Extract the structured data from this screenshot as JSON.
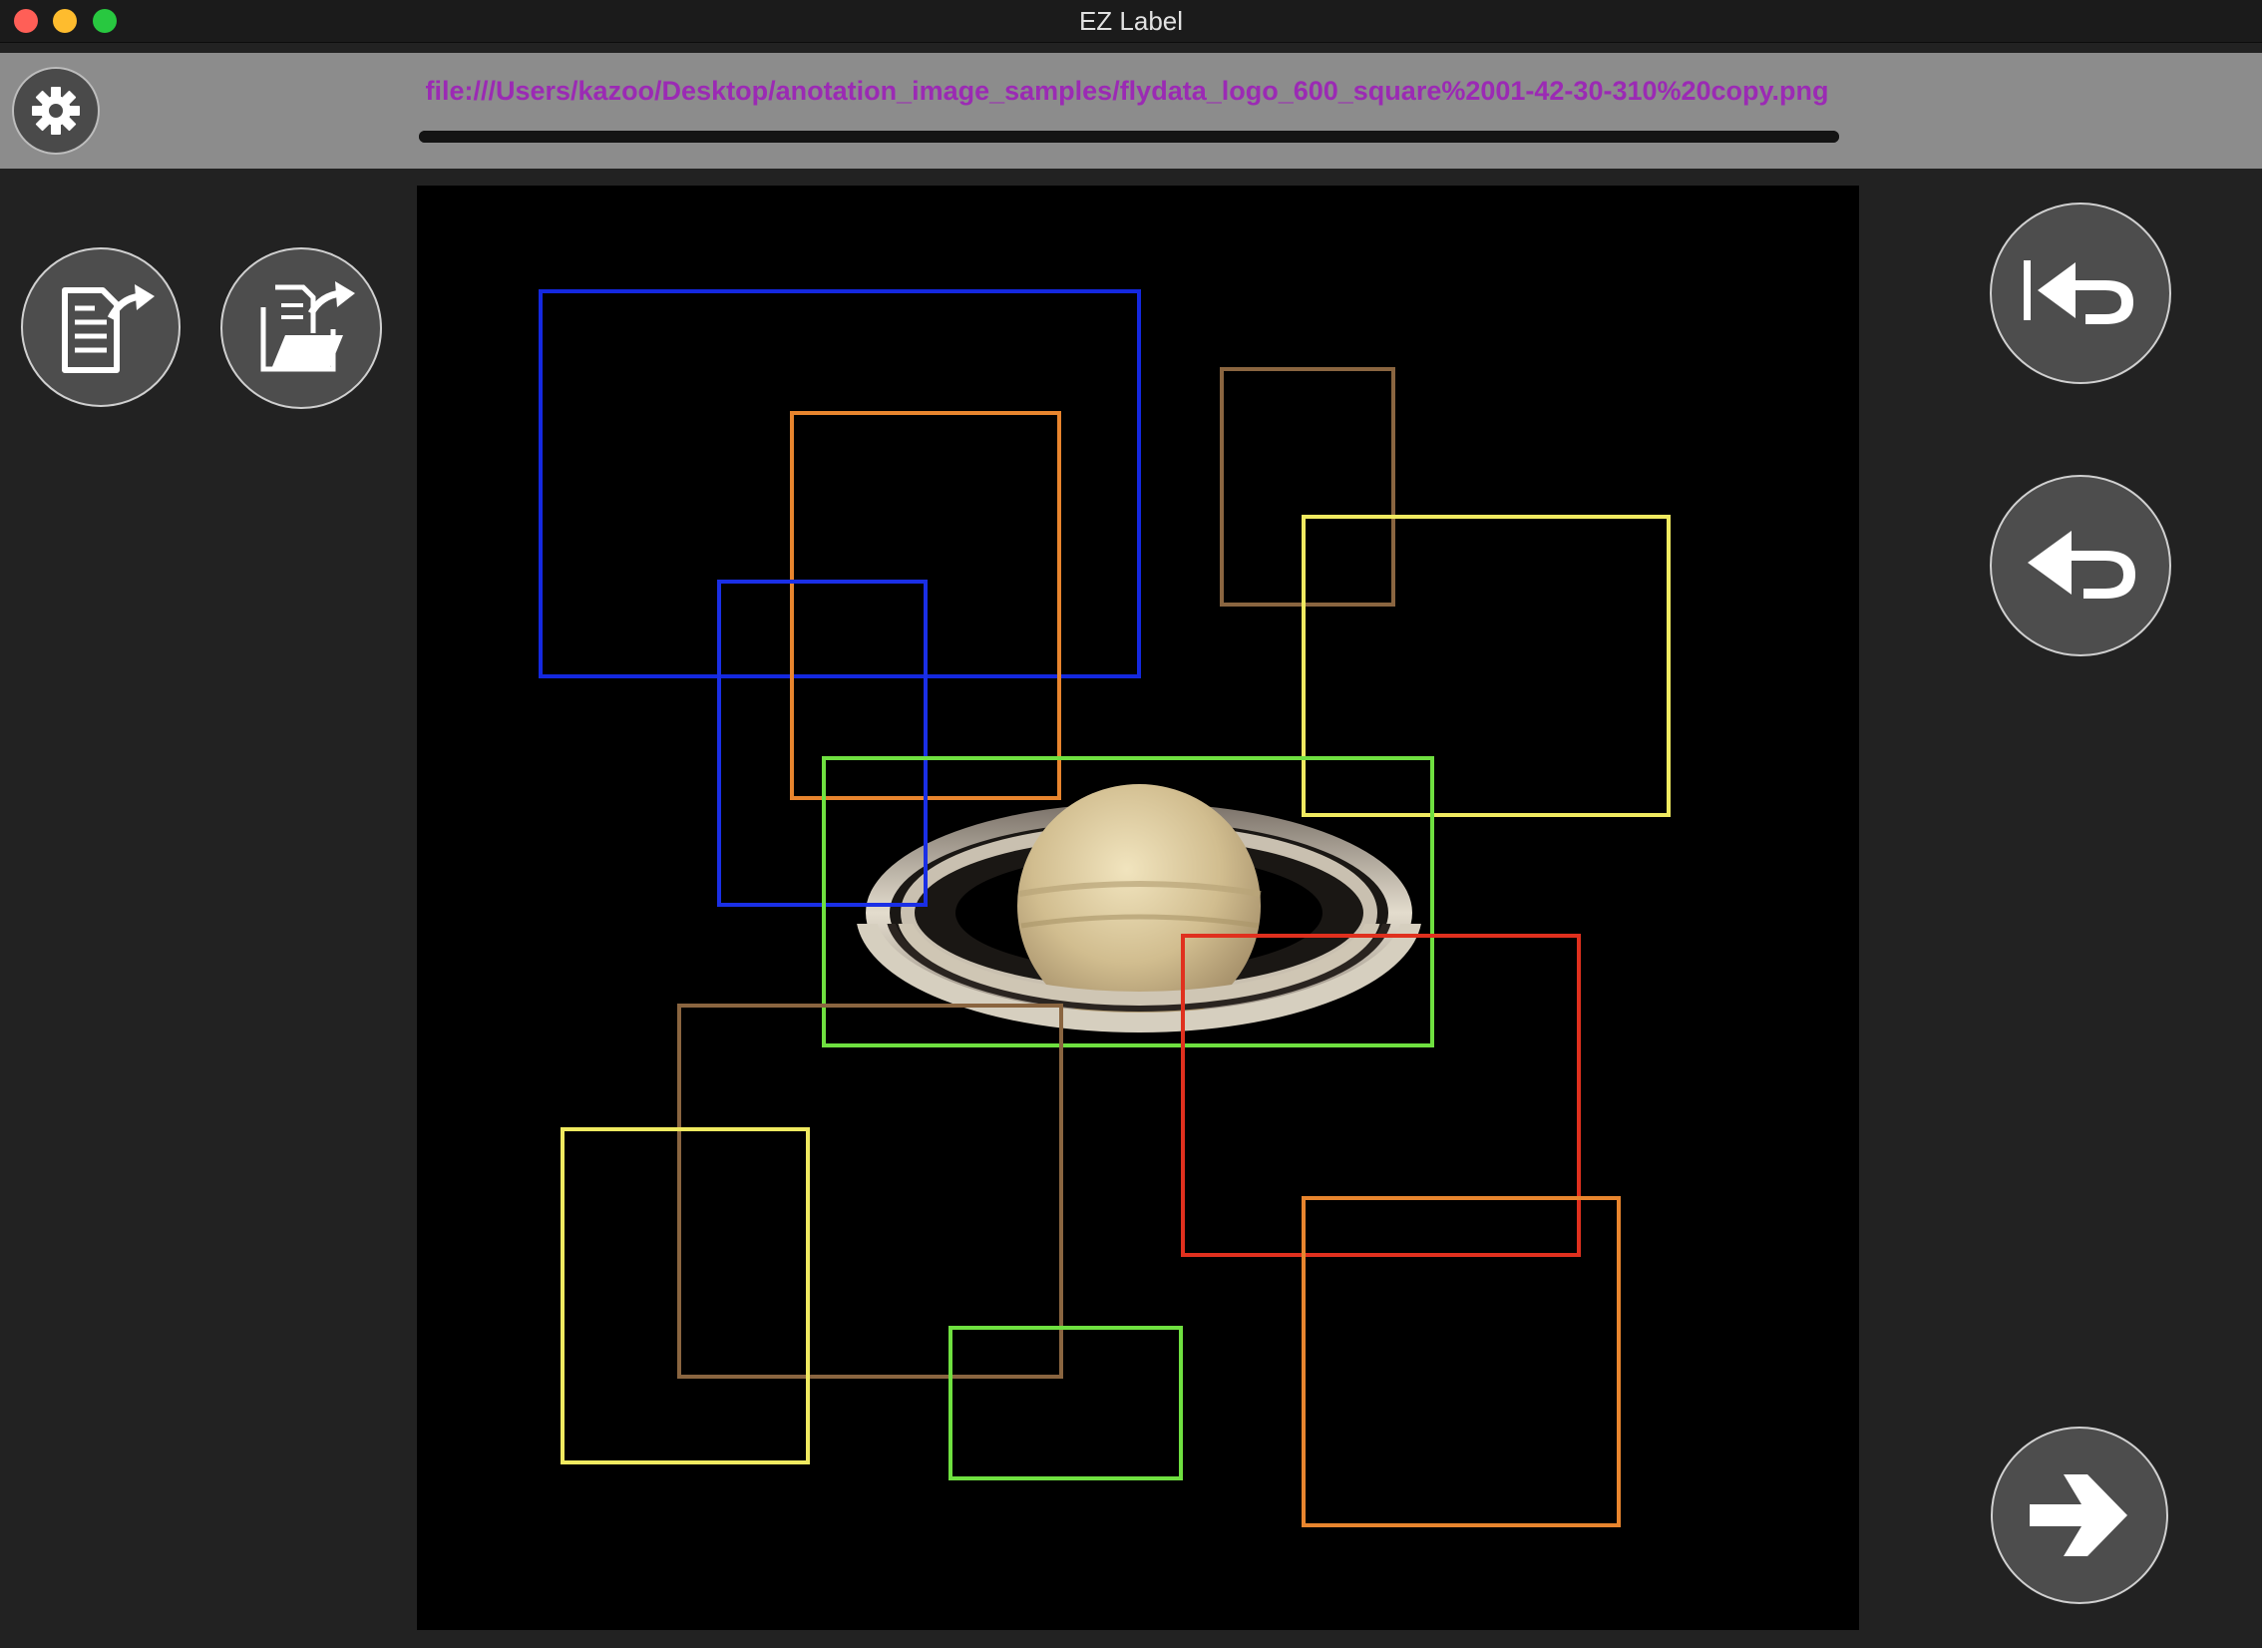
{
  "window": {
    "title": "EZ Label"
  },
  "toolbar": {
    "settings_icon": "gear-icon",
    "file_path": "file:///Users/kazoo/Desktop/anotation_image_samples/flydata_logo_600_square%2001-42-30-310%20copy.png",
    "progress": 1.0
  },
  "left_panel": {
    "buttons": [
      {
        "name": "open-file-button",
        "icon": "file-export-icon"
      },
      {
        "name": "open-folder-button",
        "icon": "folder-export-icon"
      }
    ]
  },
  "right_panel": {
    "buttons": [
      {
        "name": "undo-all-button",
        "icon": "undo-to-start-icon"
      },
      {
        "name": "undo-button",
        "icon": "undo-icon"
      },
      {
        "name": "next-button",
        "icon": "arrow-right-icon"
      }
    ]
  },
  "canvas": {
    "image_subject": "saturn",
    "boxes": [
      {
        "color": "#1428e0"
      },
      {
        "color": "#e8852e"
      },
      {
        "color": "#1a2fe6"
      },
      {
        "color": "#8a6540"
      },
      {
        "color": "#f0ea60"
      },
      {
        "color": "#6fe040"
      },
      {
        "color": "#e0301e"
      },
      {
        "color": "#8a6540"
      },
      {
        "color": "#f0ea60"
      },
      {
        "color": "#6fe040"
      },
      {
        "color": "#e8852e"
      }
    ]
  }
}
